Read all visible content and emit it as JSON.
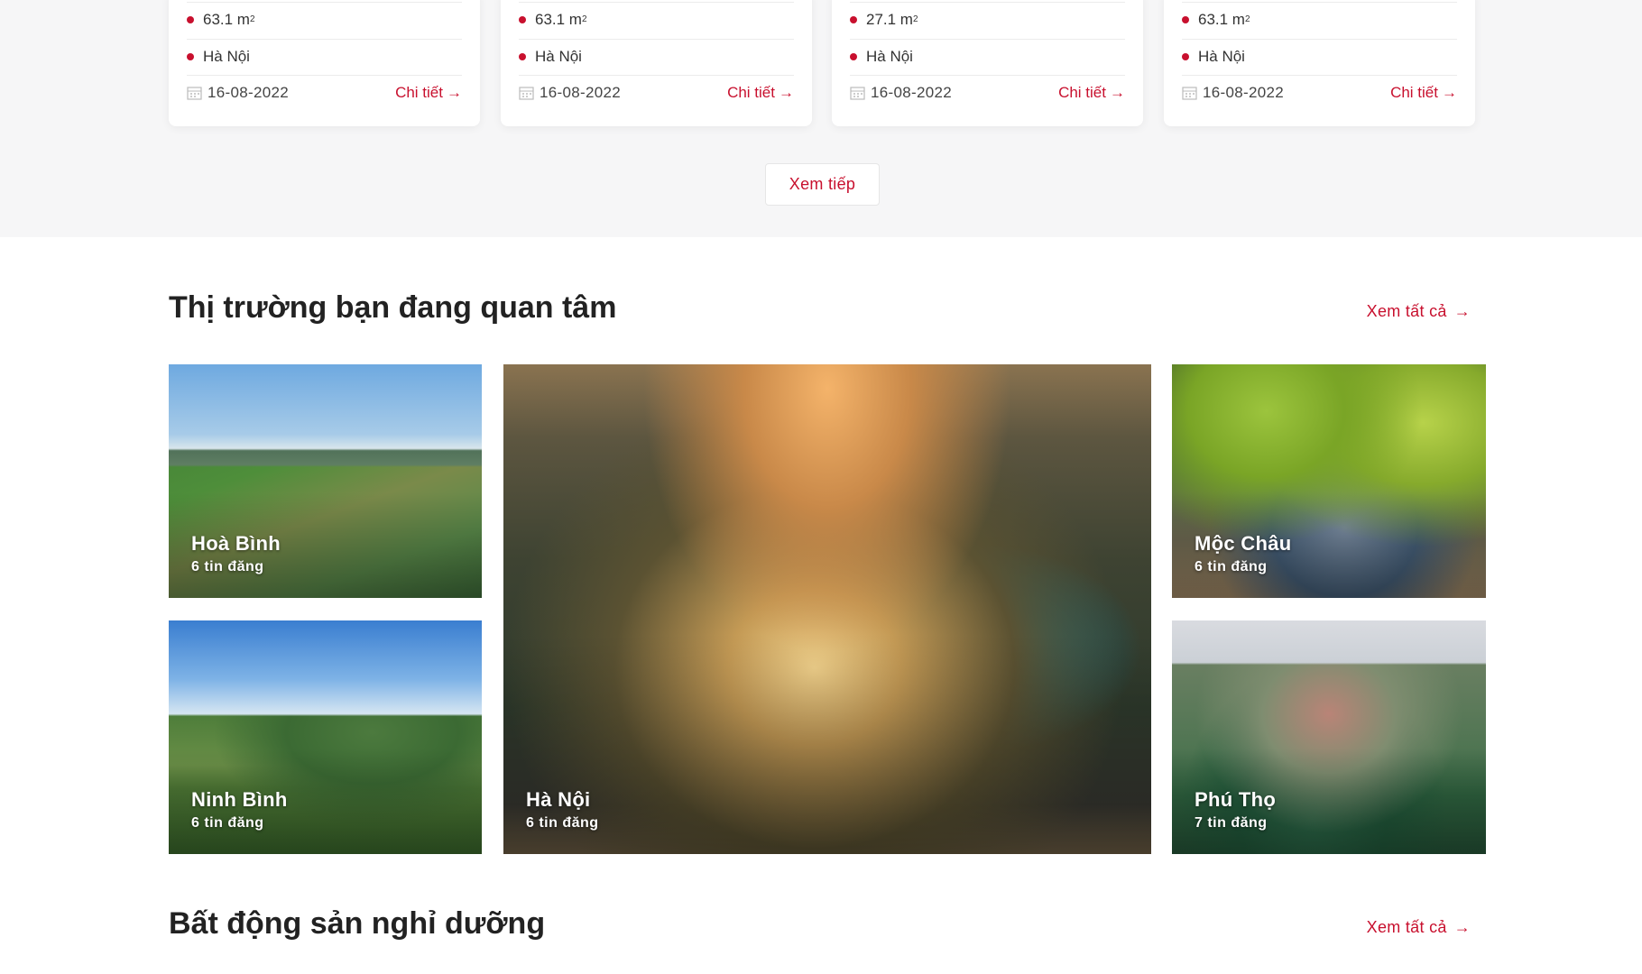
{
  "listings": [
    {
      "area": "63.1 m",
      "location": "Hà Nội",
      "date": "16-08-2022",
      "detail_label": "Chi tiết"
    },
    {
      "area": "63.1 m",
      "location": "Hà Nội",
      "date": "16-08-2022",
      "detail_label": "Chi tiết"
    },
    {
      "area": "27.1 m",
      "location": "Hà Nội",
      "date": "16-08-2022",
      "detail_label": "Chi tiết"
    },
    {
      "area": "63.1 m",
      "location": "Hà Nội",
      "date": "16-08-2022",
      "detail_label": "Chi tiết"
    }
  ],
  "area_unit_sup": "2",
  "load_more_label": "Xem tiếp",
  "market_section": {
    "title": "Thị trường bạn đang quan tâm",
    "see_all_label": "Xem tất cả",
    "tiles": [
      {
        "name": "Hoà Bình",
        "count": "6 tin đăng"
      },
      {
        "name": "Hà Nội",
        "count": "6 tin đăng"
      },
      {
        "name": "Mộc Châu",
        "count": "6 tin đăng"
      },
      {
        "name": "Ninh Bình",
        "count": "6 tin đăng"
      },
      {
        "name": "Phú Thọ",
        "count": "7 tin đăng"
      }
    ]
  },
  "resort_section": {
    "title": "Bất động sản nghỉ dưỡng",
    "see_all_label": "Xem tất cả"
  },
  "colors": {
    "accent": "#c8102e",
    "band_bg": "#f6f6f7"
  }
}
